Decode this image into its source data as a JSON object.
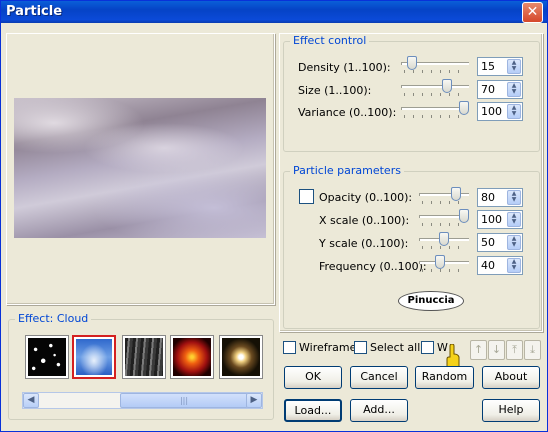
{
  "window": {
    "title": "Particle",
    "close_glyph": "✕"
  },
  "effect_control": {
    "legend": "Effect control",
    "rows": [
      {
        "label": "Density (1..100):",
        "value": "15",
        "slider_fraction": 0.1
      },
      {
        "label": "Size (1..100):",
        "value": "70",
        "slider_fraction": 0.7
      },
      {
        "label": "Variance (0..100):",
        "value": "100",
        "slider_fraction": 1.0
      }
    ]
  },
  "particle_parameters": {
    "legend": "Particle parameters",
    "rows": [
      {
        "label": "Opacity (0..100):",
        "value": "80",
        "slider_fraction": 0.8
      },
      {
        "label": "X scale (0..100):",
        "value": "100",
        "slider_fraction": 1.0
      },
      {
        "label": "Y scale (0..100):",
        "value": "50",
        "slider_fraction": 0.5
      },
      {
        "label": "Frequency (0..100):",
        "value": "40",
        "slider_fraction": 0.4
      }
    ]
  },
  "effect_group": {
    "legend": "Effect: Cloud",
    "thumbnails": [
      {
        "name": "stars-preset",
        "selected": false
      },
      {
        "name": "cloud-preset",
        "selected": true
      },
      {
        "name": "rain-preset",
        "selected": false
      },
      {
        "name": "fire-preset",
        "selected": false
      },
      {
        "name": "sparkle-preset",
        "selected": false
      }
    ],
    "scroll_left": "◀",
    "scroll_right": "▶",
    "scroll_grip": "|||"
  },
  "checkboxes": {
    "wireframe": "Wireframe",
    "select_all": "Select all",
    "w": "W"
  },
  "arrow_buttons": [
    "↑",
    "↓",
    "⤒",
    "⤓"
  ],
  "buttons": {
    "ok": "OK",
    "cancel": "Cancel",
    "random": "Random",
    "about": "About",
    "load": "Load...",
    "add": "Add...",
    "help": "Help"
  },
  "watermark": "Pinuccia",
  "colors": {
    "title_bar": "#0543c6",
    "legend_text": "#0046d5",
    "selected_border": "#d42020"
  }
}
